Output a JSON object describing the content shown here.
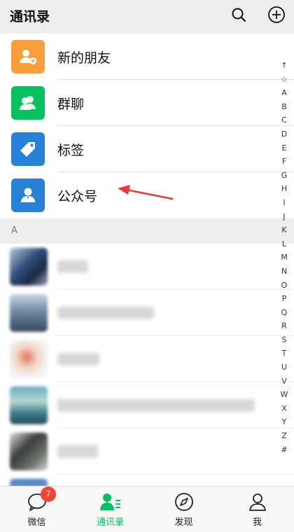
{
  "header": {
    "title": "通讯录"
  },
  "features": [
    {
      "label": "新的朋友",
      "color": "#fa9d3b",
      "icon": "add-friend-icon"
    },
    {
      "label": "群聊",
      "color": "#07c160",
      "icon": "group-chat-icon"
    },
    {
      "label": "标签",
      "color": "#2782d7",
      "icon": "tag-icon"
    },
    {
      "label": "公众号",
      "color": "#2782d7",
      "icon": "official-account-icon"
    }
  ],
  "section": {
    "letter": "A"
  },
  "index": [
    "↑",
    "☆",
    "A",
    "B",
    "C",
    "D",
    "E",
    "F",
    "G",
    "H",
    "I",
    "J",
    "K",
    "L",
    "M",
    "N",
    "O",
    "P",
    "Q",
    "R",
    "S",
    "T",
    "U",
    "V",
    "W",
    "X",
    "Y",
    "Z",
    "#"
  ],
  "tabs": [
    {
      "label": "微信",
      "icon": "chat-icon",
      "badge": "7"
    },
    {
      "label": "通讯录",
      "icon": "contacts-icon"
    },
    {
      "label": "发现",
      "icon": "compass-icon"
    },
    {
      "label": "我",
      "icon": "person-icon"
    }
  ],
  "colors": {
    "accent": "#07c160",
    "annotation": "#e53935"
  }
}
